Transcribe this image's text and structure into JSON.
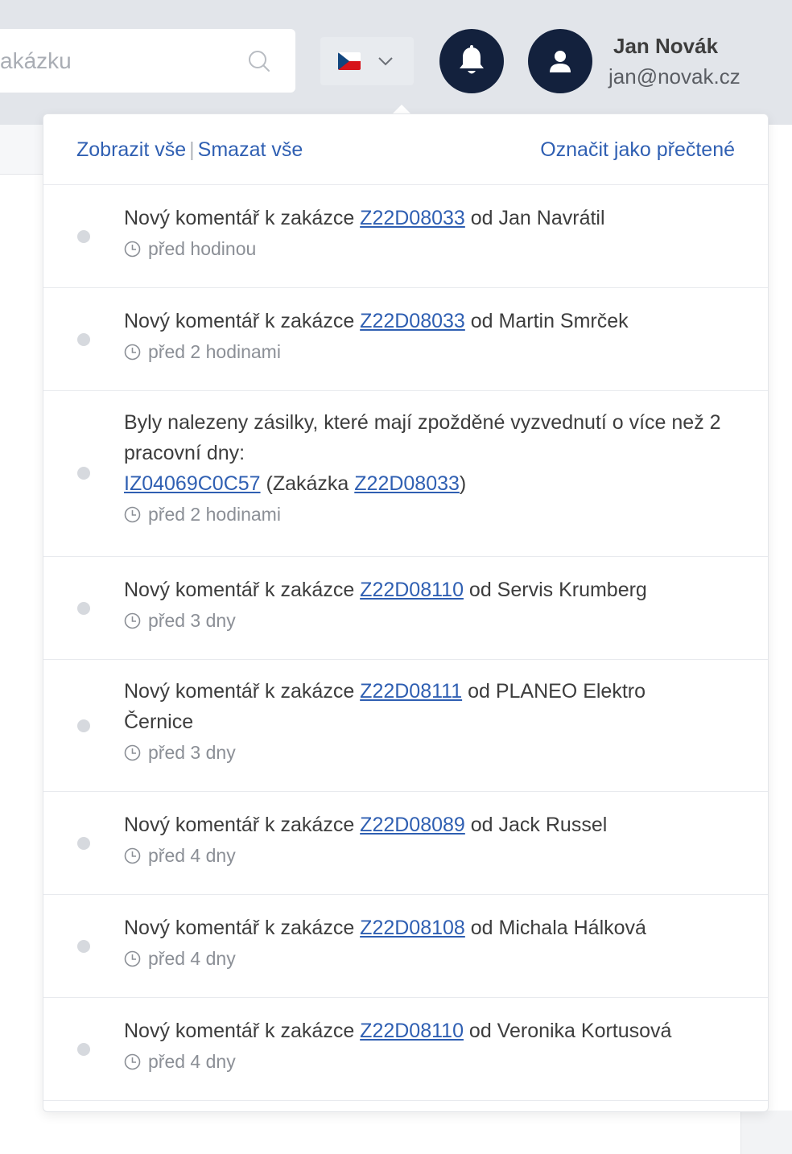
{
  "header": {
    "search_placeholder": "akázku",
    "user_name": "Jan Novák",
    "user_email": "jan@novak.cz"
  },
  "notifications": {
    "show_all": "Zobrazit vše",
    "separator": "|",
    "delete_all": "Smazat vše",
    "mark_read": "Označit jako přečtené",
    "items": [
      {
        "prefix": "Nový komentář k zakázce ",
        "link": "Z22D08033",
        "suffix": " od Jan Navrátil",
        "time": "před hodinou"
      },
      {
        "prefix": "Nový komentář k zakázce ",
        "link": "Z22D08033",
        "suffix": " od Martin Smrček",
        "time": "před 2 hodinami"
      },
      {
        "text": "Byly nalezeny zásilky, které mají zpožděné vyzvednutí o více než 2 pracovní dny:",
        "link1": "IZ04069C0C57",
        "mid": " (Zakázka ",
        "link2": "Z22D08033",
        "end": ")",
        "time": "před 2 hodinami"
      },
      {
        "prefix": "Nový komentář k zakázce ",
        "link": "Z22D08110",
        "suffix": " od Servis Krumberg",
        "time": "před 3 dny"
      },
      {
        "prefix": "Nový komentář k zakázce ",
        "link": "Z22D08111",
        "suffix": " od PLANEO Elektro Černice",
        "time": "před 3 dny"
      },
      {
        "prefix": "Nový komentář k zakázce ",
        "link": "Z22D08089",
        "suffix": " od Jack Russel",
        "time": "před 4 dny"
      },
      {
        "prefix": "Nový komentář k zakázce ",
        "link": "Z22D08108",
        "suffix": " od Michala Hálková",
        "time": "před 4 dny"
      },
      {
        "prefix": "Nový komentář k zakázce ",
        "link": "Z22D08110",
        "suffix": " od Veronika Kortusová",
        "time": "před 4 dny"
      }
    ]
  },
  "icons": {
    "search": "search-icon",
    "flag": "czech-flag-icon",
    "chevron": "chevron-down-icon",
    "bell": "bell-icon",
    "user": "user-icon",
    "clock": "clock-icon"
  },
  "colors": {
    "topbar": "#e2e5ea",
    "navy": "#13213d",
    "link": "#2f5fb2",
    "muted": "#8b8f96"
  }
}
